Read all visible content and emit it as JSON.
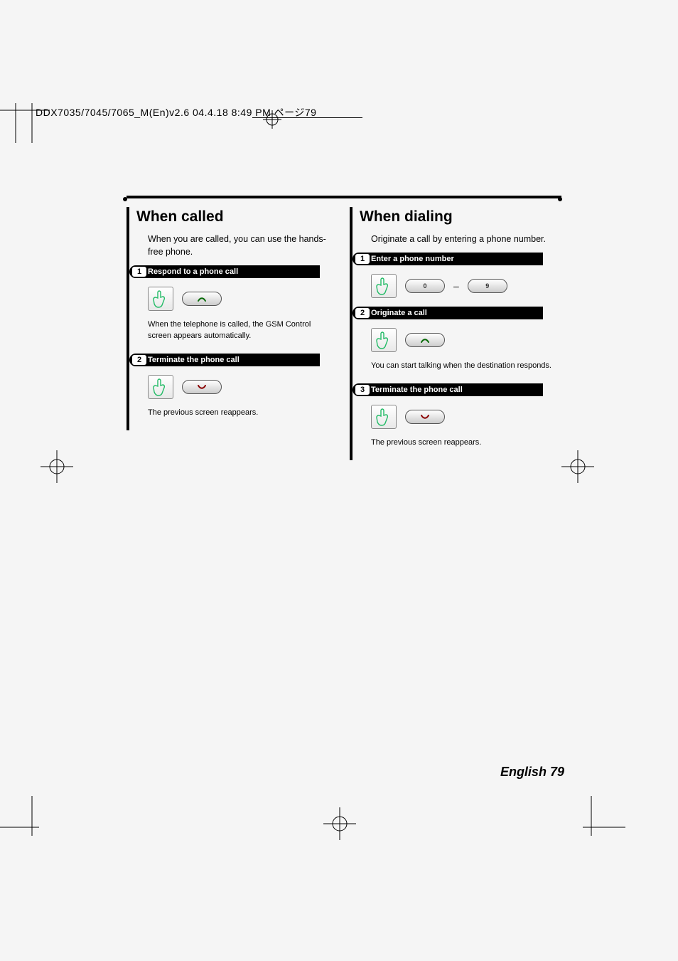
{
  "header": "DDX7035/7045/7065_M(En)v2.6  04.4.18  8:49 PM  ページ79",
  "left": {
    "title": "When called",
    "lead": "When you are called, you can use the hands-free phone.",
    "steps": [
      {
        "n": "1",
        "title": "Respond to a phone call",
        "after": "When the telephone is called, the GSM Control screen appears automatically.",
        "btn": "ans"
      },
      {
        "n": "2",
        "title": "Terminate the phone call",
        "after": "The previous screen reappears.",
        "btn": "end"
      }
    ]
  },
  "right": {
    "title": "When dialing",
    "lead": "Originate a call by entering a phone number.",
    "steps": [
      {
        "n": "1",
        "title": "Enter a phone number",
        "after": "",
        "btn": "num"
      },
      {
        "n": "2",
        "title": "Originate a call",
        "after": "You can start talking when the destination responds.",
        "btn": "ans"
      },
      {
        "n": "3",
        "title": "Terminate the phone call",
        "after": "The previous screen reappears.",
        "btn": "end"
      }
    ],
    "numpad": {
      "from": "0",
      "to": "9"
    }
  },
  "footer": {
    "lang": "English",
    "page": "79"
  }
}
